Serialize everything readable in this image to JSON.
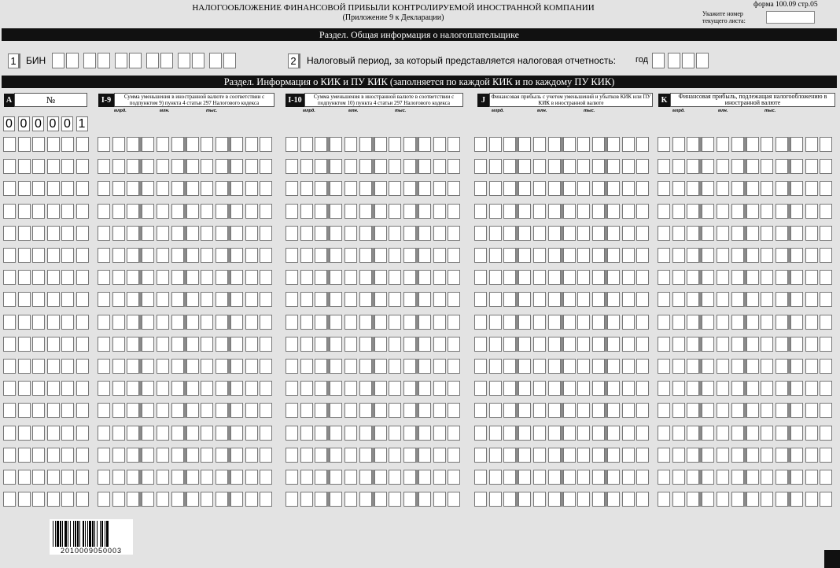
{
  "header": {
    "title": "НАЛОГООБЛОЖЕНИЕ ФИНАНСОВОЙ ПРИБЫЛИ КОНТРОЛИРУЕМОЙ ИНОСТРАННОЙ КОМПАНИИ",
    "subtitle": "(Приложение 9 к Декларации)",
    "form_number": "форма 100.09  стр.05",
    "sheet_label_line1": "Укажите номер",
    "sheet_label_line2": "текущего листа:",
    "sheet_value": ""
  },
  "section1": {
    "title": "Раздел. Общая информация о налогоплательщике",
    "field1_num": "1",
    "field1_label": "БИН",
    "field2_num": "2",
    "field2_label": "Налоговый период, за который представляется налоговая отчетность:",
    "year_label": "год"
  },
  "section2": {
    "title": "Раздел. Информация о КИК и ПУ КИК (заполняется по каждой КИК и по каждому ПУ КИК)",
    "columns": [
      {
        "letter": "A",
        "title": "№"
      },
      {
        "letter": "I-9",
        "title": "Сумма уменьшения в иностранной валюте в соответствии с подпунктом 9) пункта 4 статьи 297 Налогового кодекса"
      },
      {
        "letter": "I-10",
        "title": "Сумма уменьшения в иностранной валюте в соответствии с подпунктом 10) пункта 4 статьи 297 Налогового кодекса"
      },
      {
        "letter": "J",
        "title": "Финансовая прибыль с учетом уменьшений и убытков КИК или ПУ КИК в иностранной валюте"
      },
      {
        "letter": "K",
        "title": "Финансовая прибыль, подлежащая налогообложению в иностранной валюте"
      }
    ],
    "units": {
      "billion": "млрд.",
      "million": "млн.",
      "thousand": "тыс."
    },
    "row_number_digits": [
      "0",
      "0",
      "0",
      "0",
      "0",
      "1"
    ]
  },
  "barcode": {
    "number": "2010009050003"
  }
}
